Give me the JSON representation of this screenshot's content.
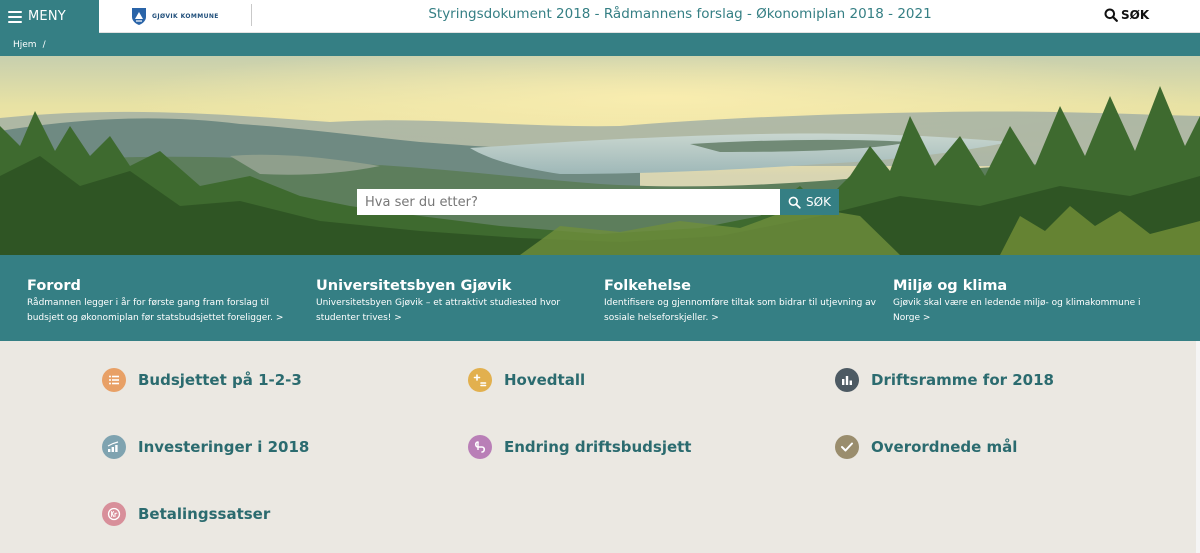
{
  "header": {
    "menu_label": "MENY",
    "logo_text": "GJØVIK KOMMUNE",
    "title": "Styringsdokument 2018 - Rådmannens forslag - Økonomiplan 2018 - 2021",
    "search_label": "SØK"
  },
  "breadcrumb": {
    "home": "Hjem",
    "separator": "/"
  },
  "hero": {
    "search_placeholder": "Hva ser du etter?",
    "search_button": "SØK"
  },
  "features": [
    {
      "title": "Forord",
      "desc": "Rådmannen legger i år for første gang fram forslag til budsjett og økonomiplan før statsbudsjettet foreligger. >"
    },
    {
      "title": "Universitetsbyen Gjøvik",
      "desc": "Universitetsbyen Gjøvik – et attraktivt studiested hvor studenter trives! >"
    },
    {
      "title": "Folkehelse",
      "desc": "Identifisere og gjennomføre tiltak som bidrar til utjevning av sosiale helseforskjeller. >"
    },
    {
      "title": "Miljø og klima",
      "desc": "Gjøvik skal være en ledende miljø- og klimakommune i Norge >"
    }
  ],
  "links": [
    {
      "label": "Budsjettet på 1-2-3",
      "icon": "list-icon",
      "color": "#e8a066"
    },
    {
      "label": "Hovedtall",
      "icon": "plus-minus-icon",
      "color": "#e2b04e"
    },
    {
      "label": "Driftsramme for 2018",
      "icon": "bar-chart-icon",
      "color": "#4d5a63"
    },
    {
      "label": "Investeringer i 2018",
      "icon": "growth-chart-icon",
      "color": "#7fa3b0"
    },
    {
      "label": "Endring driftsbudsjett",
      "icon": "wave-icon",
      "color": "#b97fb7"
    },
    {
      "label": "Overordnede mål",
      "icon": "check-icon",
      "color": "#9a8d6d"
    },
    {
      "label": "Betalingssatser",
      "icon": "kr-coin-icon",
      "color": "#d88f9a"
    }
  ],
  "colors": {
    "brand": "#357f84",
    "grid_bg": "#ebe8e2",
    "link_text": "#2b6b6f"
  }
}
